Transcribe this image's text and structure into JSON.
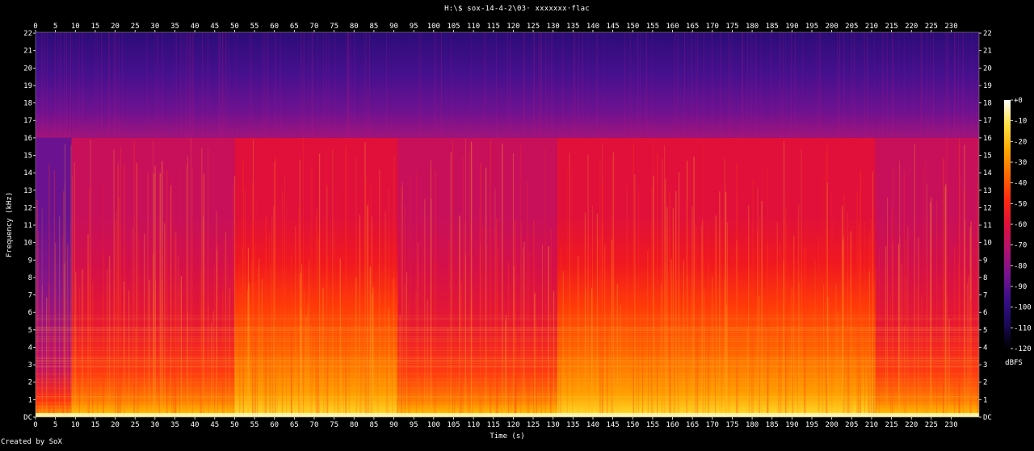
{
  "window": {
    "title": "H:\\$ sox-14-4-2\\03· xxxxxxx·flac",
    "credit": "Created by SoX"
  },
  "chart_data": {
    "type": "heatmap",
    "title": "H:\\$ sox-14-4-2\\03· xxxxxxx·flac",
    "xlabel": "Time (s)",
    "ylabel": "Frequency (kHz)",
    "xlim": [
      0,
      237
    ],
    "ylim": [
      0,
      22.05
    ],
    "x_ticks": [
      0,
      5,
      10,
      15,
      20,
      25,
      30,
      35,
      40,
      45,
      50,
      55,
      60,
      65,
      70,
      75,
      80,
      85,
      90,
      95,
      100,
      105,
      110,
      115,
      120,
      125,
      130,
      135,
      140,
      145,
      150,
      155,
      160,
      165,
      170,
      175,
      180,
      185,
      190,
      195,
      200,
      205,
      210,
      215,
      220,
      225,
      230
    ],
    "y_ticks": [
      "DC",
      "1",
      "2",
      "3",
      "4",
      "5",
      "6",
      "7",
      "8",
      "9",
      "10",
      "11",
      "12",
      "13",
      "14",
      "15",
      "16",
      "17",
      "18",
      "19",
      "20",
      "21",
      "22"
    ],
    "colorbar": {
      "label": "dBFS",
      "range": [
        -120,
        0
      ],
      "ticks": [
        "+0",
        "-10",
        "-20",
        "-30",
        "-40",
        "-50",
        "-60",
        "-70",
        "-80",
        "-90",
        "-100",
        "-110",
        "-120"
      ],
      "stops": [
        "#000000",
        "#1a0a5a",
        "#3a0f8a",
        "#7a138f",
        "#b0126e",
        "#e0103a",
        "#ff2a10",
        "#ff6a00",
        "#ffa800",
        "#ffe040",
        "#ffffff"
      ]
    },
    "lowpass_cutoff_khz": 16,
    "sections": [
      {
        "start": 0,
        "end": 9,
        "level": "quiet"
      },
      {
        "start": 9,
        "end": 50,
        "level": "medium"
      },
      {
        "start": 50,
        "end": 91,
        "level": "loud"
      },
      {
        "start": 91,
        "end": 131,
        "level": "medium"
      },
      {
        "start": 131,
        "end": 211,
        "level": "loud"
      },
      {
        "start": 211,
        "end": 237,
        "level": "medium"
      }
    ],
    "grid": false,
    "legend": "right"
  }
}
